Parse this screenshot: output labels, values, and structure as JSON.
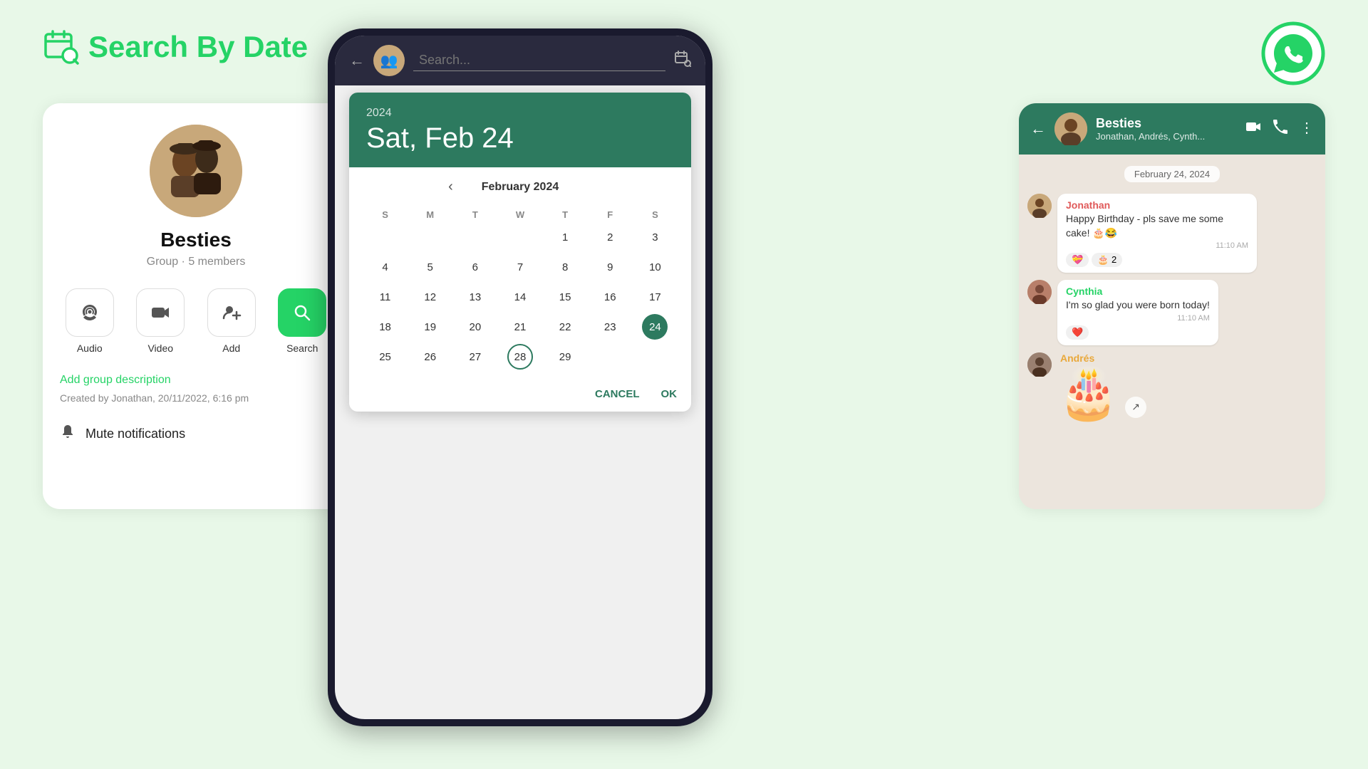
{
  "background_color": "#e8f8e8",
  "header": {
    "icon": "calendar-search",
    "title_green": "Search",
    "title_rest": " By Date"
  },
  "whatsapp_logo": "whatsapp",
  "left_card": {
    "group_name": "Besties",
    "group_info": "Group · 5 members",
    "buttons": [
      {
        "id": "audio",
        "icon": "📞",
        "label": "Audio",
        "active": false
      },
      {
        "id": "video",
        "icon": "📹",
        "label": "Video",
        "active": false
      },
      {
        "id": "add",
        "icon": "👥",
        "label": "Add",
        "active": false
      },
      {
        "id": "search",
        "icon": "🔍",
        "label": "Search",
        "active": true
      }
    ],
    "add_description": "Add group description",
    "created_info": "Created by Jonathan, 20/11/2022, 6:16 pm",
    "mute_label": "Mute notifications"
  },
  "phone": {
    "search_placeholder": "Search...",
    "calendar_dialog": {
      "year": "2024",
      "date_display": "Sat, Feb 24",
      "month_title": "February 2024",
      "day_headers": [
        "S",
        "M",
        "T",
        "W",
        "T",
        "F",
        "S"
      ],
      "days": [
        {
          "day": "",
          "state": "empty"
        },
        {
          "day": "",
          "state": "empty"
        },
        {
          "day": "",
          "state": "empty"
        },
        {
          "day": "",
          "state": "empty"
        },
        {
          "day": "1",
          "state": "normal"
        },
        {
          "day": "2",
          "state": "normal"
        },
        {
          "day": "3",
          "state": "normal"
        },
        {
          "day": "4",
          "state": "normal"
        },
        {
          "day": "5",
          "state": "normal"
        },
        {
          "day": "6",
          "state": "normal"
        },
        {
          "day": "7",
          "state": "normal"
        },
        {
          "day": "8",
          "state": "normal"
        },
        {
          "day": "9",
          "state": "normal"
        },
        {
          "day": "10",
          "state": "normal"
        },
        {
          "day": "11",
          "state": "normal"
        },
        {
          "day": "12",
          "state": "normal"
        },
        {
          "day": "13",
          "state": "normal"
        },
        {
          "day": "14",
          "state": "normal"
        },
        {
          "day": "15",
          "state": "normal"
        },
        {
          "day": "16",
          "state": "normal"
        },
        {
          "day": "17",
          "state": "normal"
        },
        {
          "day": "18",
          "state": "normal"
        },
        {
          "day": "19",
          "state": "normal"
        },
        {
          "day": "20",
          "state": "normal"
        },
        {
          "day": "21",
          "state": "normal"
        },
        {
          "day": "22",
          "state": "normal"
        },
        {
          "day": "23",
          "state": "normal"
        },
        {
          "day": "24",
          "state": "selected"
        },
        {
          "day": "25",
          "state": "normal"
        },
        {
          "day": "26",
          "state": "normal"
        },
        {
          "day": "27",
          "state": "normal"
        },
        {
          "day": "28",
          "state": "circled"
        },
        {
          "day": "29",
          "state": "normal"
        }
      ],
      "cancel_label": "Cancel",
      "ok_label": "OK"
    }
  },
  "right_card": {
    "chat_name": "Besties",
    "chat_members": "Jonathan, Andrés, Cynth...",
    "date_badge": "February 24, 2024",
    "messages": [
      {
        "sender": "Jonathan",
        "sender_class": "jonathan",
        "text": "Happy Birthday - pls save me some cake! 🎂😂",
        "time": "11:10 AM",
        "reactions": [
          "💝",
          "🎂",
          "2"
        ],
        "avatar": "J"
      },
      {
        "sender": "Cynthia",
        "sender_class": "cynthia",
        "text": "I'm so glad you were born today!",
        "time": "11:10 AM",
        "reactions": [
          "❤️"
        ],
        "avatar": "C"
      },
      {
        "sender": "Andrés",
        "sender_class": "andres",
        "text": "🎂",
        "time": "",
        "reactions": [],
        "avatar": "A",
        "is_sticker": true
      }
    ]
  }
}
